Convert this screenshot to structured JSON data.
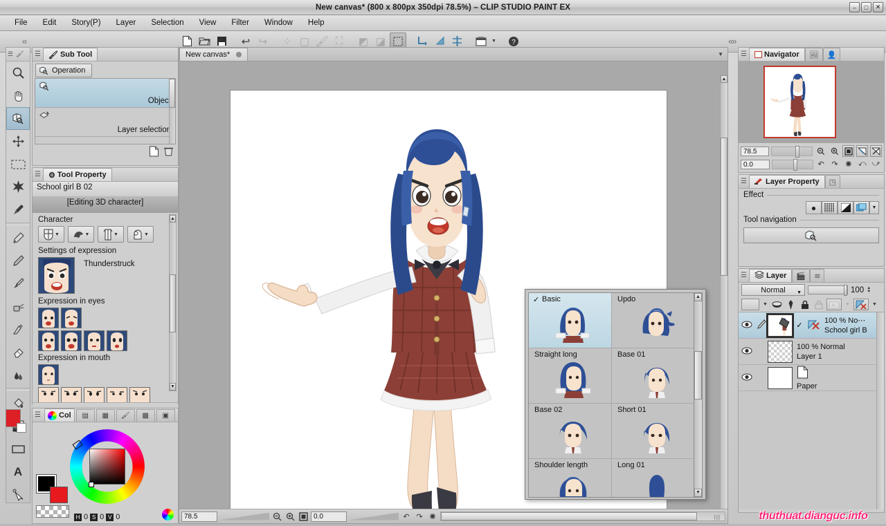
{
  "window": {
    "title": "New canvas* (800 x 800px 350dpi 78.5%) – CLIP STUDIO PAINT EX",
    "minimize": "–",
    "maximize": "□",
    "close": "✕"
  },
  "menubar": {
    "items": [
      "File",
      "Edit",
      "Story(P)",
      "Layer",
      "Selection",
      "View",
      "Filter",
      "Window",
      "Help"
    ]
  },
  "toolbar": {
    "icons": [
      {
        "name": "new-file-icon",
        "glyph": "🗋",
        "state": "enabled"
      },
      {
        "name": "open-file-icon",
        "glyph": "🗁",
        "state": "enabled"
      },
      {
        "name": "save-file-icon",
        "glyph": "🖫",
        "state": "enabled"
      },
      {
        "name": "undo-icon",
        "glyph": "↩",
        "state": "enabled"
      },
      {
        "name": "redo-icon",
        "glyph": "↪",
        "state": "disabled"
      },
      {
        "name": "clear-icon",
        "glyph": "⁂",
        "state": "disabled"
      },
      {
        "name": "fill-selection-icon",
        "glyph": "▢",
        "state": "disabled"
      },
      {
        "name": "fill-outside-icon",
        "glyph": "🖌",
        "state": "disabled"
      },
      {
        "name": "scale-rotate-icon",
        "glyph": "⛶",
        "state": "disabled"
      },
      {
        "name": "select-area-icon",
        "glyph": "◩",
        "state": "disabled"
      },
      {
        "name": "deselect-icon",
        "glyph": "◪",
        "state": "disabled"
      },
      {
        "name": "selection-marquee-icon",
        "glyph": "▦",
        "state": "selected"
      },
      {
        "name": "ruler-snap-icon",
        "glyph": "◣",
        "state": "blue"
      },
      {
        "name": "special-ruler-icon",
        "glyph": "◢",
        "state": "blue"
      },
      {
        "name": "symmetrical-ruler-icon",
        "glyph": "⫯",
        "state": "blue"
      },
      {
        "name": "frame-border-icon",
        "glyph": "▤",
        "state": "enabled"
      },
      {
        "name": "help-icon",
        "glyph": "?",
        "state": "enabled"
      }
    ],
    "collapse_left": "«",
    "collapse_right": "«»"
  },
  "tool_palette": {
    "tools": [
      {
        "name": "magnifier-tool",
        "glyph": "🔍",
        "selected": false
      },
      {
        "name": "hand-tool",
        "glyph": "✋",
        "selected": false
      },
      {
        "name": "operation-tool",
        "glyph": "🔍",
        "selected": true
      },
      {
        "name": "move-layer-tool",
        "glyph": "✥",
        "selected": false
      },
      {
        "name": "marquee-tool",
        "glyph": "▭",
        "selected": false
      },
      {
        "name": "auto-select-tool",
        "glyph": "✳",
        "selected": false
      },
      {
        "name": "eyedropper-tool",
        "glyph": "🖊",
        "selected": false
      },
      {
        "name": "pen-tool",
        "glyph": "✒",
        "selected": false
      },
      {
        "name": "pencil-tool",
        "glyph": "✏",
        "selected": false
      },
      {
        "name": "brush-tool",
        "glyph": "🖌",
        "selected": false
      },
      {
        "name": "airbrush-tool",
        "glyph": "🎨",
        "selected": false
      },
      {
        "name": "decoration-tool",
        "glyph": "❧",
        "selected": false
      },
      {
        "name": "eraser-tool",
        "glyph": "⌫",
        "selected": false
      },
      {
        "name": "blend-tool",
        "glyph": "☁",
        "selected": false
      },
      {
        "name": "fill-tool",
        "glyph": "🪣",
        "selected": false
      },
      {
        "name": "gradient-tool",
        "glyph": "▩",
        "selected": false
      },
      {
        "name": "figure-tool",
        "glyph": "▭",
        "selected": false
      },
      {
        "name": "text-tool",
        "glyph": "A",
        "selected": false
      },
      {
        "name": "balloon-tool",
        "glyph": "➤",
        "selected": false
      }
    ]
  },
  "sub_tool": {
    "tab_label": "Sub Tool",
    "active_button": "Operation",
    "items": [
      {
        "label": "Object",
        "selected": true
      },
      {
        "label": "Layer selection",
        "selected": false
      }
    ],
    "footer_icons": [
      "new-setting-icon",
      "delete-icon"
    ]
  },
  "tool_property": {
    "tab_label": "Tool Property",
    "object_name": "School girl B 02",
    "edit_mode": "[Editing 3D character]",
    "character_group_label": "Character",
    "character_buttons": [
      {
        "name": "body-type-button",
        "glyph": "⊕"
      },
      {
        "name": "hair-style-button",
        "glyph": "🐎"
      },
      {
        "name": "clothing-button",
        "glyph": "👕"
      },
      {
        "name": "accessory-button",
        "glyph": "🔒"
      }
    ],
    "expression_settings_label": "Settings of expression",
    "expression_name": "Thunderstruck",
    "eyes_label": "Expression in eyes",
    "eyes_count_row1": 2,
    "eyes_count_row2": 4,
    "mouth_label": "Expression in mouth",
    "mouth_count_row1": 1,
    "mouth_count_row2": 5
  },
  "color_panel": {
    "tab_label": "Col",
    "tabs": [
      "color-wheel-tab",
      "color-set-tab",
      "intermediate-color-tab",
      "color-slider-tab",
      "approx-color-tab",
      "color-history-tab"
    ],
    "hsv": [
      {
        "key": "H",
        "value": "0"
      },
      {
        "key": "S",
        "value": "0"
      },
      {
        "key": "V",
        "value": "0"
      }
    ],
    "main_color": "#000000",
    "sub_color": "#e8181f"
  },
  "canvas": {
    "tab_label": "New canvas*",
    "zoom": "78.5",
    "rotation": "0.0",
    "status_buttons": [
      "zoom-out-button",
      "zoom-in-button",
      "fit-to-screen-button",
      "rotate-left-button",
      "rotate-right-button",
      "reset-rotation-button"
    ]
  },
  "hair_popup": {
    "items": [
      {
        "label": "Basic",
        "selected": true
      },
      {
        "label": "Updo",
        "selected": false
      },
      {
        "label": "Straight long",
        "selected": false
      },
      {
        "label": "Base 01",
        "selected": false
      },
      {
        "label": "Base 02",
        "selected": false
      },
      {
        "label": "Short 01",
        "selected": false
      },
      {
        "label": "Shoulder length",
        "selected": false
      },
      {
        "label": "Long 01",
        "selected": false
      }
    ],
    "check_glyph": "✓"
  },
  "navigator": {
    "tab_label": "Navigator",
    "other_tabs": [
      "sub-view-tab",
      "item-bank-tab"
    ],
    "zoom_value": "78.5",
    "rotation_value": "0.0",
    "buttons": [
      "zoom-out-button",
      "zoom-in-button",
      "fit-button",
      "flip-horizontal-button",
      "flip-vertical-button",
      "rotate-left-button",
      "rotate-right-button",
      "reset-button",
      "rotate-90-left-button",
      "rotate-90-right-button"
    ]
  },
  "layer_property": {
    "tab_label": "Layer Property",
    "other_tab": "animation-cels-tab",
    "effect_label": "Effect",
    "effect_buttons": [
      "border-effect-icon",
      "tone-effect-icon",
      "layer-color-icon",
      "extract-line-icon",
      "more-caret-icon"
    ],
    "tool_navigation_label": "Tool navigation",
    "tool_navigation_icon": "object-cube-icon"
  },
  "layer_panel": {
    "tab_label": "Layer",
    "other_tabs": [
      "animation-tab",
      "layer-search-tab"
    ],
    "blend_mode": "Normal",
    "opacity": "100",
    "toolbar_icons": [
      "palette-color-icon",
      "clip-to-layer-icon",
      "reference-layer-icon",
      "lock-layer-icon",
      "lock-transparent-icon",
      "mask-enable-icon",
      "ruler-show-icon"
    ],
    "layers": [
      {
        "name": "School girl B",
        "opacity_mode": "100 %  No⋯",
        "selected": true,
        "visible": true,
        "type": "3d"
      },
      {
        "name": "Layer 1",
        "opacity_mode": "100 %  Normal",
        "selected": false,
        "visible": true,
        "type": "raster"
      },
      {
        "name": "Paper",
        "opacity_mode": "",
        "selected": false,
        "visible": true,
        "type": "paper"
      }
    ]
  },
  "watermark": {
    "text": "thuthuat.dianguc.info"
  }
}
